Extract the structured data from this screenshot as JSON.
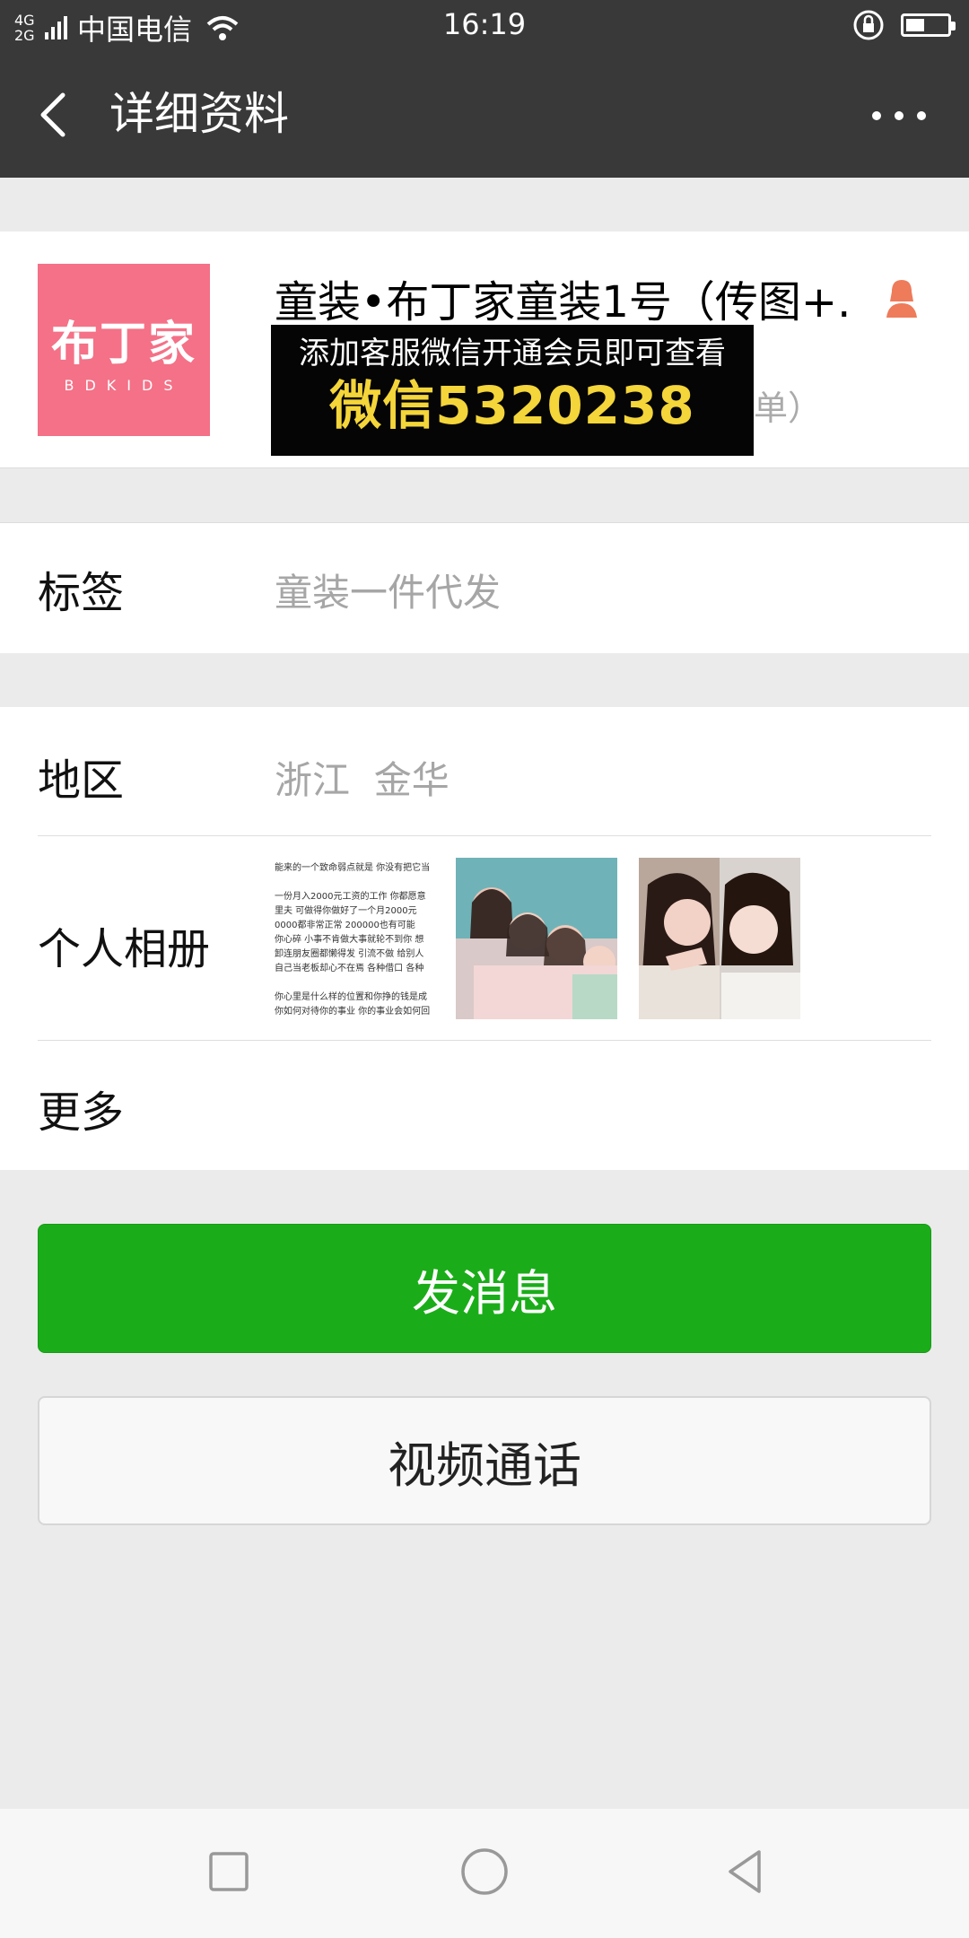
{
  "status_bar": {
    "network": "4G\n2G",
    "carrier": "中国电信",
    "time": "16:19",
    "battery_level": 0.45
  },
  "nav": {
    "title": "详细资料"
  },
  "profile": {
    "avatar_text": "布丁家",
    "avatar_subtext": "BDKIDS",
    "name": "童装•布丁家童装1号（传图+...",
    "partial_text": "单）",
    "promo_line1": "添加客服微信开通会员即可查看",
    "promo_line2": "微信5320238"
  },
  "tags": {
    "label": "标签",
    "value": "童装一件代发"
  },
  "region": {
    "label": "地区",
    "value": "浙江  金华"
  },
  "album": {
    "label": "个人相册",
    "thumb1_lines": [
      "能来的一个致命弱点就是 你没有把它当",
      "",
      "一份月入2000元工资的工作 你都愿意",
      "里夫 可做得你做好了一个月2000元",
      "0000都非常正常 200000也有可能",
      "你心碎 小事不肯做大事就轮不到你 想",
      "卸连朋友圈都懒得发 引流不做 给别人",
      "自己当老板却心不在焉 各种借口 各种",
      "",
      "你心里是什么样的位置和你挣的钱是成",
      "你如何对待你的事业 你的事业会如何回"
    ]
  },
  "more": {
    "label": "更多"
  },
  "buttons": {
    "send_message": "发消息",
    "video_call": "视频通话"
  }
}
